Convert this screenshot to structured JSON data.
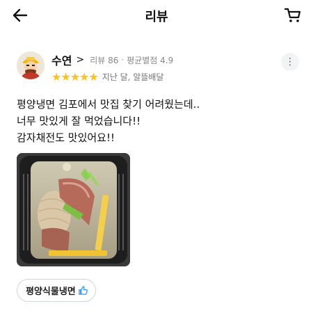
{
  "header": {
    "title": "리뷰",
    "back_icon": "arrow-left-icon",
    "cart_icon": "shopping-cart-icon"
  },
  "review": {
    "username": "수연",
    "chevron": ">",
    "review_count": "리뷰 86",
    "separator": "·",
    "average_rating": "평균별점 4.9",
    "stars": "★★★★★",
    "rating": 5,
    "posted": "지난 달, 알뜰배달",
    "more_icon": "more-vertical-icon",
    "more_glyph": "⋮",
    "text_lines": [
      "평양냉면 김포에서 맛집 찾기 어려웠는데..",
      "너무 맛있게 잘 먹었습니다!!",
      "감자채전도 맛있어요!!"
    ],
    "menu_tag": "평양식물냉면",
    "tag_icon": "thumbs-up-icon"
  },
  "colors": {
    "star": "#fcc419",
    "thumb": "#339af0",
    "meta_text": "#888888"
  }
}
